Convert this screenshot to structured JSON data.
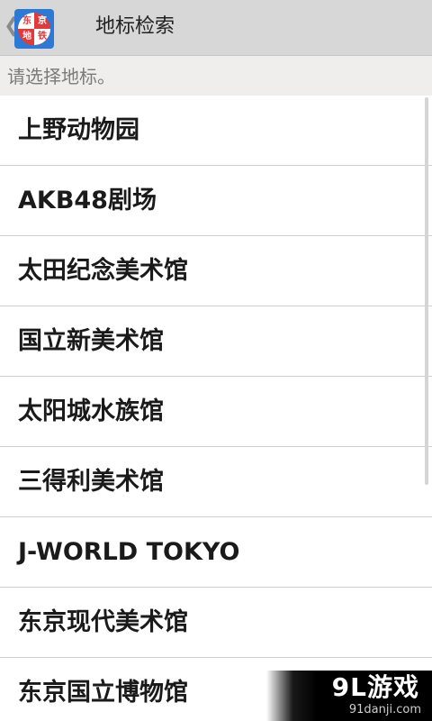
{
  "header": {
    "back_icon": "chevron-left-icon",
    "app_icon": {
      "name": "tokyo-subway-logo",
      "chars": [
        "东",
        "京",
        "地",
        "铁"
      ],
      "colors": {
        "blue": "#2d7ad6",
        "red": "#e23a3a",
        "white": "#ffffff"
      }
    },
    "title": "地标检索"
  },
  "subheader": {
    "hint": "请选择地标。"
  },
  "landmarks": [
    "上野动物园",
    "AKB48剧场",
    "太田纪念美术馆",
    "国立新美术馆",
    "太阳城水族馆",
    "三得利美术馆",
    "J-WORLD TOKYO",
    "东京现代美术馆",
    "东京国立博物馆"
  ],
  "watermark": {
    "brand": "9L游戏",
    "url": "91danji.com"
  }
}
